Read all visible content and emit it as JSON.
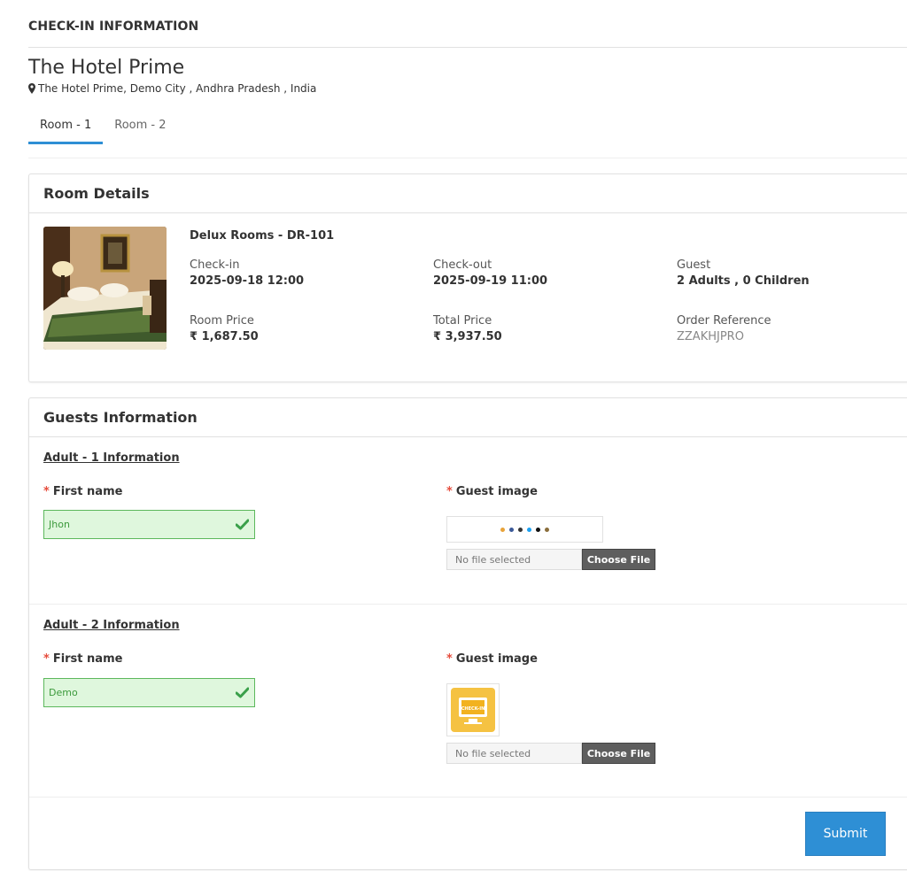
{
  "page": {
    "heading": "CHECK-IN INFORMATION"
  },
  "hotel": {
    "name": "The Hotel Prime",
    "address": "The Hotel Prime, Demo City , Andhra Pradesh , India"
  },
  "tabs": [
    {
      "label": "Room - 1",
      "active": true
    },
    {
      "label": "Room - 2",
      "active": false
    }
  ],
  "room_details": {
    "title": "Room Details",
    "room_name": "Delux Rooms - DR-101",
    "check_in_label": "Check-in",
    "check_in_value": "2025-09-18 12:00",
    "check_out_label": "Check-out",
    "check_out_value": "2025-09-19 11:00",
    "guest_label": "Guest",
    "guest_value": "2 Adults , 0 Children",
    "room_price_label": "Room Price",
    "room_price_value": "₹ 1,687.50",
    "total_price_label": "Total Price",
    "total_price_value": "₹ 3,937.50",
    "order_ref_label": "Order Reference",
    "order_ref_value": "ZZAKHJPRO"
  },
  "guests": {
    "title": "Guests Information",
    "adults": [
      {
        "section_title": "Adult - 1  Information",
        "first_name_label": "First name",
        "first_name_value": "Jhon",
        "guest_image_label": "Guest image",
        "file_status": "No file selected",
        "file_button": "Choose File"
      },
      {
        "section_title": "Adult - 2  Information",
        "first_name_label": "First name",
        "first_name_value": "Demo",
        "guest_image_label": "Guest image",
        "file_status": "No file selected",
        "file_button": "Choose File",
        "thumbnail_text": "CHECK-IN"
      }
    ],
    "required_mark": "*"
  },
  "actions": {
    "submit_label": "Submit"
  },
  "colors": {
    "accent": "#2e8fd5",
    "valid_bg": "#dff7dd",
    "valid_border": "#5cb85c",
    "required": "#e64c3c"
  },
  "icons": {
    "location": "map-marker-icon",
    "valid": "check-icon"
  }
}
